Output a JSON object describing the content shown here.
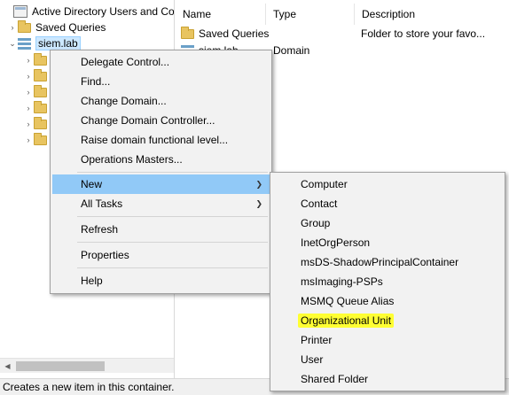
{
  "tree": {
    "root_label": "Active Directory Users and Com",
    "saved_queries": "Saved Queries",
    "domain": "siem.lab"
  },
  "list": {
    "columns": [
      "Name",
      "Type",
      "Description"
    ],
    "rows": [
      {
        "name": "Saved Queries",
        "type": "",
        "description": "Folder to store your favo..."
      },
      {
        "name": "siem.lab",
        "type": "Domain",
        "description": ""
      }
    ]
  },
  "context_menu": {
    "items": [
      "Delegate Control...",
      "Find...",
      "Change Domain...",
      "Change Domain Controller...",
      "Raise domain functional level...",
      "Operations Masters...",
      "New",
      "All Tasks",
      "Refresh",
      "Properties",
      "Help"
    ]
  },
  "new_submenu": {
    "items": [
      "Computer",
      "Contact",
      "Group",
      "InetOrgPerson",
      "msDS-ShadowPrincipalContainer",
      "msImaging-PSPs",
      "MSMQ Queue Alias",
      "Organizational Unit",
      "Printer",
      "User",
      "Shared Folder"
    ],
    "highlighted": "Organizational Unit",
    "highlight_color": "#ffff33"
  },
  "status_bar": {
    "text": "Creates a new item in this container."
  },
  "colors": {
    "menu_hover": "#91c9f7",
    "tree_selection": "#cce8ff"
  }
}
